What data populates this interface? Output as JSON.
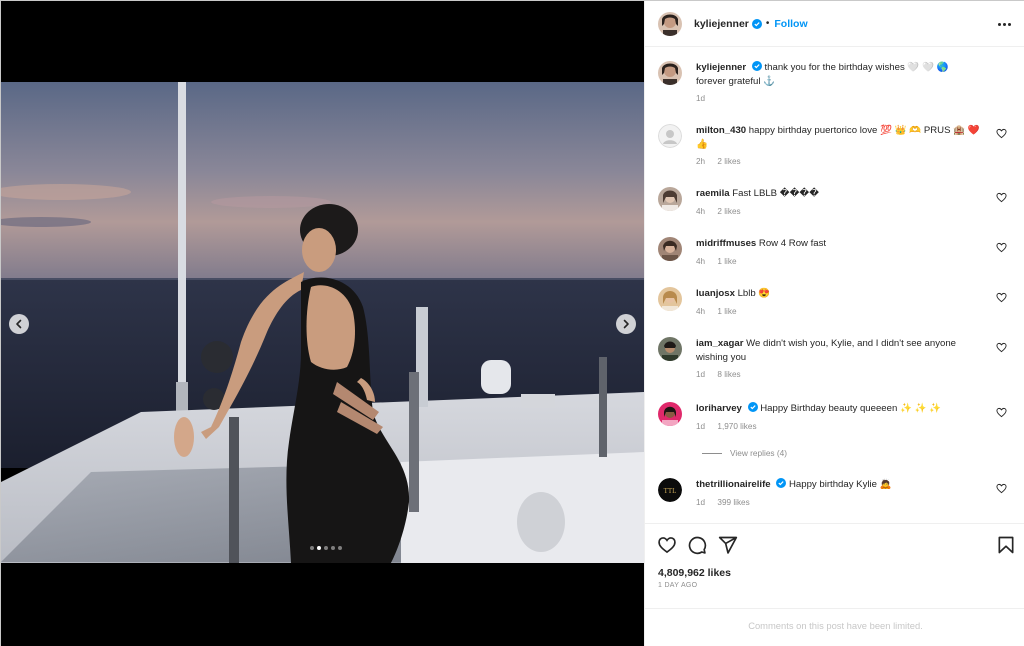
{
  "post": {
    "author": "kyliejenner",
    "follow_label": "Follow",
    "separator": "•",
    "image_count": 5,
    "active_image": 2
  },
  "caption": {
    "user": "kyliejenner",
    "text": "thank you for the birthday wishes 🤍 🤍 🌎 forever grateful ⚓",
    "time": "1d"
  },
  "comments": [
    {
      "user": "milton_430",
      "text": "happy birthday puertorico love 💯 👑 🫶 PRUS 🏨 ❤️ 👍",
      "time": "2h",
      "likes": "2 likes",
      "verified": false
    },
    {
      "user": "raemila",
      "text": "Fast LBLB ����",
      "time": "4h",
      "likes": "2 likes",
      "verified": false
    },
    {
      "user": "midriffmuses",
      "text": "Row 4 Row fast",
      "time": "4h",
      "likes": "1 like",
      "verified": false
    },
    {
      "user": "luanjosx",
      "text": "Lblb 😍",
      "time": "4h",
      "likes": "1 like",
      "verified": false
    },
    {
      "user": "iam_xagar",
      "text": "We didn't wish you, Kylie, and I didn't see anyone wishing you",
      "time": "1d",
      "likes": "8 likes",
      "verified": false
    },
    {
      "user": "loriharvey",
      "text": "Happy Birthday beauty queeeen ✨ ✨ ✨",
      "time": "1d",
      "likes": "1,970 likes",
      "verified": true
    },
    {
      "user": "thetrillionairelife",
      "text": "Happy birthday Kylie 🙇",
      "time": "1d",
      "likes": "399 likes",
      "verified": true
    }
  ],
  "view_replies": "View replies (4)",
  "likes_count": "4,809,962 likes",
  "posted_ago": "1 DAY AGO",
  "comments_limited": "Comments on this post have been limited.",
  "icons": {
    "more": "more-options-icon",
    "like": "heart-icon",
    "comment": "comment-icon",
    "share": "share-icon",
    "save": "bookmark-icon",
    "prev": "chevron-left-icon",
    "next": "chevron-right-icon"
  },
  "colors": {
    "accent": "#0095f6",
    "verified": "#0095f6",
    "text": "#262626",
    "muted": "#8e8e8e"
  }
}
